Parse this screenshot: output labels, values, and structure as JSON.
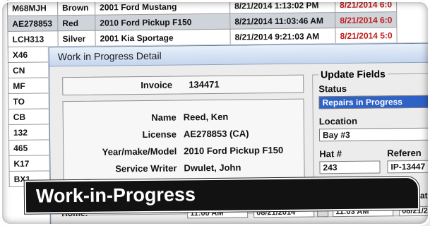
{
  "table": {
    "rows": [
      {
        "plate": "M68MJH",
        "color": "Brown",
        "vehicle": "2001 Ford Mustang",
        "date_in": "8/21/2014 1:13:02 PM",
        "date_out": "8/21/2014 6:0",
        "selected": false
      },
      {
        "plate": "AE278853",
        "color": "Red",
        "vehicle": "2010 Ford Pickup F150",
        "date_in": "8/21/2014 11:03:46 AM",
        "date_out": "8/21/2014 6:0",
        "selected": true
      },
      {
        "plate": "LCH313",
        "color": "Silver",
        "vehicle": "2001 Kia Sportage",
        "date_in": "8/21/2014 9:21:03 AM",
        "date_out": "8/21/2014 5:0",
        "selected": false
      },
      {
        "plate": "X46",
        "color": "",
        "vehicle": "",
        "date_in": "",
        "date_out": "",
        "selected": false
      },
      {
        "plate": "CN",
        "color": "",
        "vehicle": "",
        "date_in": "",
        "date_out": "",
        "selected": false
      },
      {
        "plate": "MF",
        "color": "",
        "vehicle": "",
        "date_in": "",
        "date_out": "",
        "selected": false
      },
      {
        "plate": "TO",
        "color": "",
        "vehicle": "",
        "date_in": "",
        "date_out": "",
        "selected": false
      },
      {
        "plate": "CB",
        "color": "",
        "vehicle": "",
        "date_in": "",
        "date_out": "",
        "selected": false
      },
      {
        "plate": "132",
        "color": "",
        "vehicle": "",
        "date_in": "",
        "date_out": "",
        "selected": false
      },
      {
        "plate": "465",
        "color": "",
        "vehicle": "",
        "date_in": "",
        "date_out": "",
        "selected": false
      },
      {
        "plate": "K17",
        "color": "",
        "vehicle": "",
        "date_in": "",
        "date_out": "",
        "selected": false
      },
      {
        "plate": "BX1",
        "color": "",
        "vehicle": "",
        "date_in": "",
        "date_out": "",
        "selected": false
      }
    ]
  },
  "dialog": {
    "title": "Work in Progress Detail",
    "invoice_label": "Invoice",
    "invoice_number": "134471",
    "name_label": "Name",
    "name_value": "Reed, Ken",
    "license_label": "License",
    "license_value": "AE278853 (CA)",
    "ymm_label": "Year/make/Model",
    "ymm_value": "2010 Ford Pickup F150",
    "writer_label": "Service Writer",
    "writer_value": "Dwulet, John",
    "home_label": "Home:",
    "update_group_title": "Update Fields",
    "status_label": "Status",
    "status_value": "Repairs in Progress",
    "location_label": "Location",
    "location_value": "Bay #3",
    "hat_label": "Hat #",
    "hat_value": "243",
    "reference_label": "Referen",
    "reference_value": "IP-13447",
    "bottom_fields": [
      "11:00 AM",
      "08/21/2014",
      "11:03 AM",
      "08/21/2"
    ],
    "bottom_right_label": "ate"
  },
  "caption": {
    "text": "Work-in-Progress"
  }
}
